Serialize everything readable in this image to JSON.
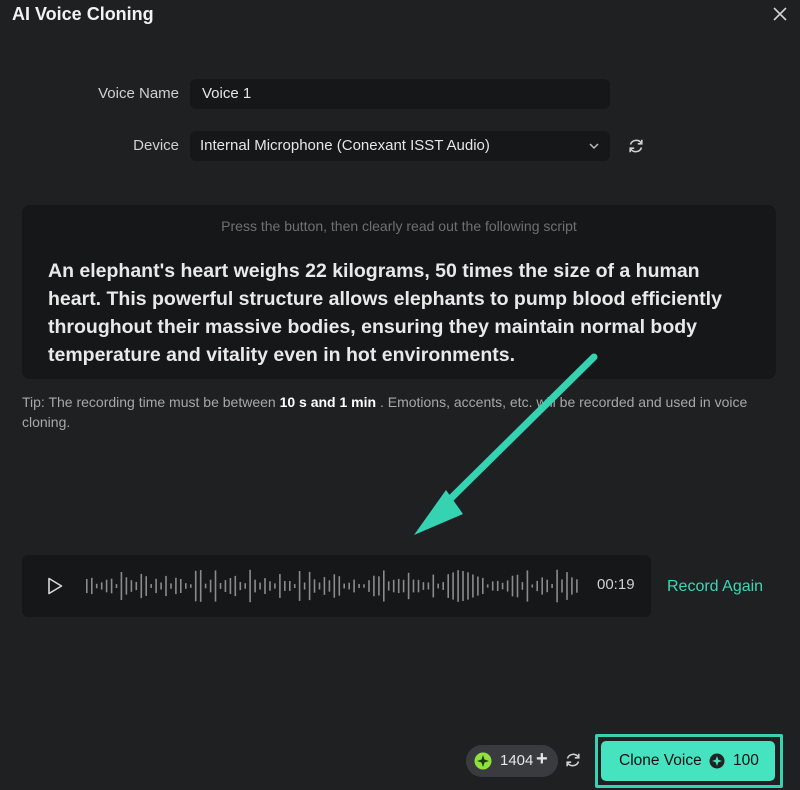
{
  "dialog": {
    "title": "AI Voice Cloning"
  },
  "form": {
    "voice_name_label": "Voice Name",
    "voice_name_value": "Voice 1",
    "device_label": "Device",
    "device_value": "Internal Microphone (Conexant ISST Audio)"
  },
  "script": {
    "hint": "Press the button, then clearly read out the following script",
    "text": "An elephant's heart weighs 22 kilograms, 50 times the size of a human heart. This powerful structure allows elephants to pump blood efficiently throughout their massive bodies, ensuring they maintain normal body temperature and vitality even in hot environments."
  },
  "tip": {
    "prefix": "Tip: The recording time must be between ",
    "highlight": "10 s and 1 min",
    "suffix": " . Emotions, accents, etc. will be recorded and used in voice cloning."
  },
  "player": {
    "duration": "00:19",
    "record_again_label": "Record Again"
  },
  "footer": {
    "credits": "1404",
    "credits_plus": "+",
    "clone_label": "Clone Voice",
    "clone_cost": "100"
  },
  "colors": {
    "accent": "#46e3c1",
    "accent_outline": "#35d3b2",
    "background": "#1f2022",
    "panel": "#161719"
  },
  "icons": {
    "close": "close-icon",
    "dropdown": "chevron-down-icon",
    "refresh": "refresh-icon",
    "play": "play-icon",
    "credit": "credit-coin-icon",
    "cost": "credit-coin-icon"
  }
}
